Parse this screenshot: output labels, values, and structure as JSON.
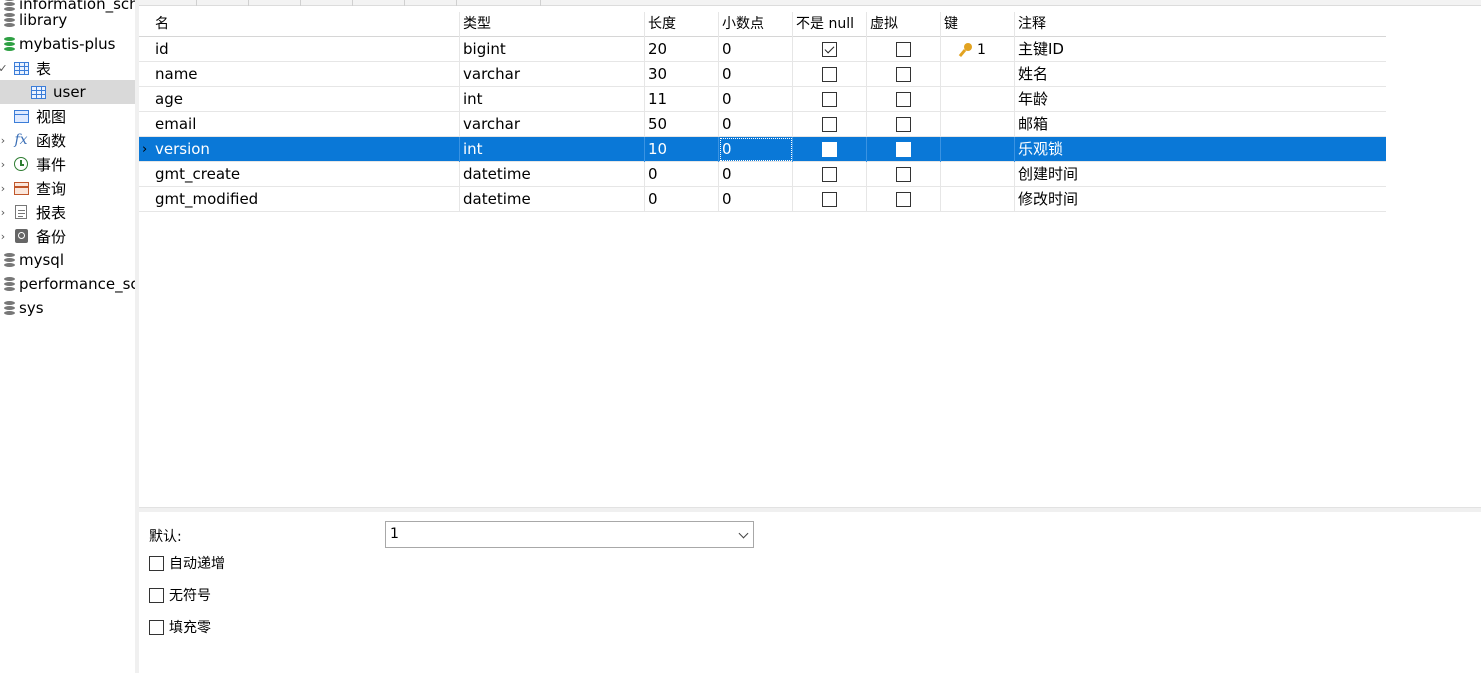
{
  "sidebar": {
    "items": [
      {
        "label": "information_sch",
        "icon": "database-icon"
      },
      {
        "label": "library",
        "icon": "database-icon"
      },
      {
        "label": "mybatis-plus",
        "icon": "database-icon"
      },
      {
        "label": "表",
        "icon": "table-group-icon",
        "expanded": true
      },
      {
        "label": "user",
        "icon": "table-icon",
        "selected": true
      },
      {
        "label": "视图",
        "icon": "view-icon"
      },
      {
        "label": "函数",
        "icon": "function-icon"
      },
      {
        "label": "事件",
        "icon": "event-icon"
      },
      {
        "label": "查询",
        "icon": "query-icon"
      },
      {
        "label": "报表",
        "icon": "report-icon"
      },
      {
        "label": "备份",
        "icon": "backup-icon"
      },
      {
        "label": "mysql",
        "icon": "database-icon"
      },
      {
        "label": "performance_sc",
        "icon": "database-icon"
      },
      {
        "label": "sys",
        "icon": "database-icon"
      }
    ]
  },
  "grid": {
    "headers": [
      "名",
      "类型",
      "长度",
      "小数点",
      "不是 null",
      "虚拟",
      "键",
      "注释"
    ],
    "rows": [
      {
        "name": "id",
        "type": "bigint",
        "length": "20",
        "decimals": "0",
        "not_null": true,
        "virtual": false,
        "key": "1",
        "comment": "主键ID"
      },
      {
        "name": "name",
        "type": "varchar",
        "length": "30",
        "decimals": "0",
        "not_null": false,
        "virtual": false,
        "key": "",
        "comment": "姓名"
      },
      {
        "name": "age",
        "type": "int",
        "length": "11",
        "decimals": "0",
        "not_null": false,
        "virtual": false,
        "key": "",
        "comment": "年龄"
      },
      {
        "name": "email",
        "type": "varchar",
        "length": "50",
        "decimals": "0",
        "not_null": false,
        "virtual": false,
        "key": "",
        "comment": "邮箱"
      },
      {
        "name": "version",
        "type": "int",
        "length": "10",
        "decimals": "0",
        "not_null": false,
        "virtual": false,
        "key": "",
        "comment": "乐观锁",
        "selected": true
      },
      {
        "name": "gmt_create",
        "type": "datetime",
        "length": "0",
        "decimals": "0",
        "not_null": false,
        "virtual": false,
        "key": "",
        "comment": "创建时间"
      },
      {
        "name": "gmt_modified",
        "type": "datetime",
        "length": "0",
        "decimals": "0",
        "not_null": false,
        "virtual": false,
        "key": "",
        "comment": "修改时间"
      }
    ],
    "selected_color": "#0a78d7",
    "key_icon": "key-icon"
  },
  "properties": {
    "default_label": "默认:",
    "default_value": "1",
    "auto_increment_label": "自动递增",
    "unsigned_label": "无符号",
    "zerofill_label": "填充零"
  }
}
